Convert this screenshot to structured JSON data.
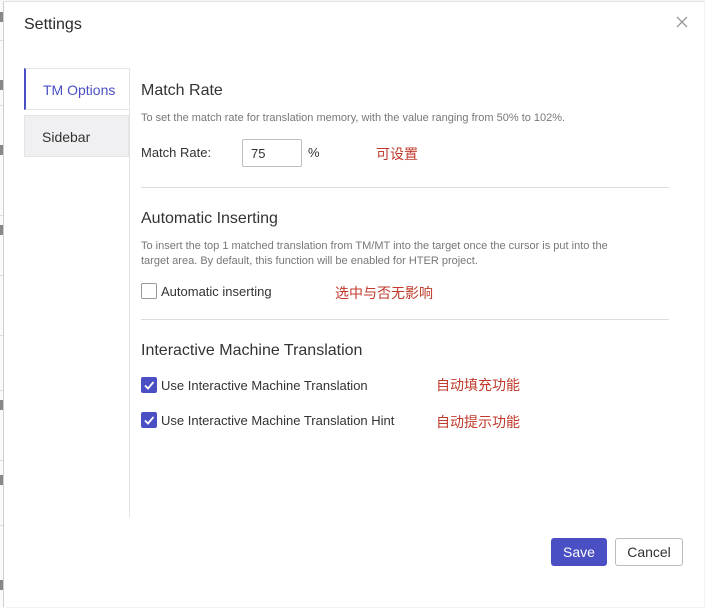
{
  "dialog": {
    "title": "Settings",
    "close_icon": "close-icon"
  },
  "sidebar": {
    "tabs": [
      {
        "label": "TM Options",
        "active": true
      },
      {
        "label": "Sidebar",
        "active": false
      }
    ]
  },
  "match_rate": {
    "title": "Match Rate",
    "description": "To set the match rate for translation memory, with the value ranging from 50% to 102%.",
    "label": "Match Rate:",
    "value": "75",
    "unit": "%",
    "note": "可设置"
  },
  "automatic_inserting": {
    "title": "Automatic Inserting",
    "description_line1": "To insert the top 1 matched translation from TM/MT into the target once the cursor is put into the",
    "description_line2": "target area. By default, this function will be enabled for HTER project.",
    "checkbox_label": "Automatic inserting",
    "checked": false,
    "note": "选中与否无影响"
  },
  "imt": {
    "title": "Interactive Machine Translation",
    "options": [
      {
        "label": "Use Interactive Machine Translation",
        "checked": true,
        "note": "自动填充功能"
      },
      {
        "label": "Use Interactive Machine Translation Hint",
        "checked": true,
        "note": "自动提示功能"
      }
    ]
  },
  "footer": {
    "save_label": "Save",
    "cancel_label": "Cancel"
  },
  "colors": {
    "accent": "#4a4fc4",
    "note_red": "#c0392b"
  }
}
